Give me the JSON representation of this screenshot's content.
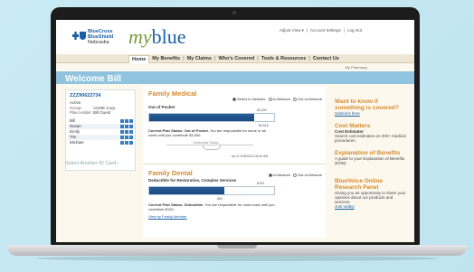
{
  "header": {
    "brand_line1": "BlueCross",
    "brand_line2": "BlueShield",
    "brand_line3": "Nebraska",
    "app_name_my": "my",
    "app_name_blue": "blue",
    "top_links": [
      "Adjust View ▾",
      "|",
      "Account Settings",
      "|",
      "Log Out"
    ]
  },
  "nav": {
    "items": [
      "Home",
      "My Benefits",
      "My Claims",
      "Who's Covered",
      "Tools & Resources",
      "Contact Us"
    ],
    "active": "Home",
    "sub": "My Pharmacy"
  },
  "welcome": "Welcome Bill",
  "idcard": {
    "number": "ZZZ90622734",
    "status": "Active",
    "group_label": "Group:",
    "group_value": "ACME Corp.",
    "holder_label": "Plan Holder:",
    "holder_value": "Bill Guest",
    "members": [
      "Bill",
      "Susan",
      "Emily",
      "Tim",
      "Michael"
    ],
    "select_another": "Select Another ID Card"
  },
  "medical": {
    "title": "Family Medical",
    "radios": [
      "Select In-Network",
      "In-Network",
      "Out-of-Network"
    ],
    "label": "Out of Pocket",
    "max": "$3,000",
    "value": "$2,518",
    "progress": 0.84,
    "status_bold": "Current Plan Status: Out of Pocket.",
    "status_rest": " You are responsible for some or all costs until you contribute $3,000.",
    "deductible_status": "Deductible Status",
    "as_of": "As of 2/28/2014 05:44 AM"
  },
  "dental": {
    "title": "Family Dental",
    "radios": [
      "In-Network",
      "Out-of-Network"
    ],
    "label": "Deductible for Restorative, Complex Services",
    "max": "$100",
    "value": "$60",
    "progress": 0.6,
    "status_bold": "Current Plan Status: Deductible.",
    "status_rest": " You are responsible for most costs until you contribute $100.",
    "link": "View by Family Member"
  },
  "right": {
    "want_to_know": "Want to know if something is covered?",
    "submit": "Submit it here",
    "cost_title": "Cost Matters",
    "cost_sub_bold": "Cost Estimator",
    "cost_sub": "Search cost estimates on 200+ medical procedures.",
    "explanation_title": "Explanation of Benefits",
    "explanation_sub": "A guide to your Explanation of Benefits (EOB)",
    "panel_title": "BlueVoice Online Research Panel",
    "panel_sub": "Giving you an opportunity to share your opinions about our products and services.",
    "panel_link": "Join today!"
  },
  "colors": {
    "brand_blue": "#1a5fa8",
    "accent_orange": "#d58a2a",
    "welcome_bar": "#8fc3de",
    "background": "#fdf8ee"
  }
}
